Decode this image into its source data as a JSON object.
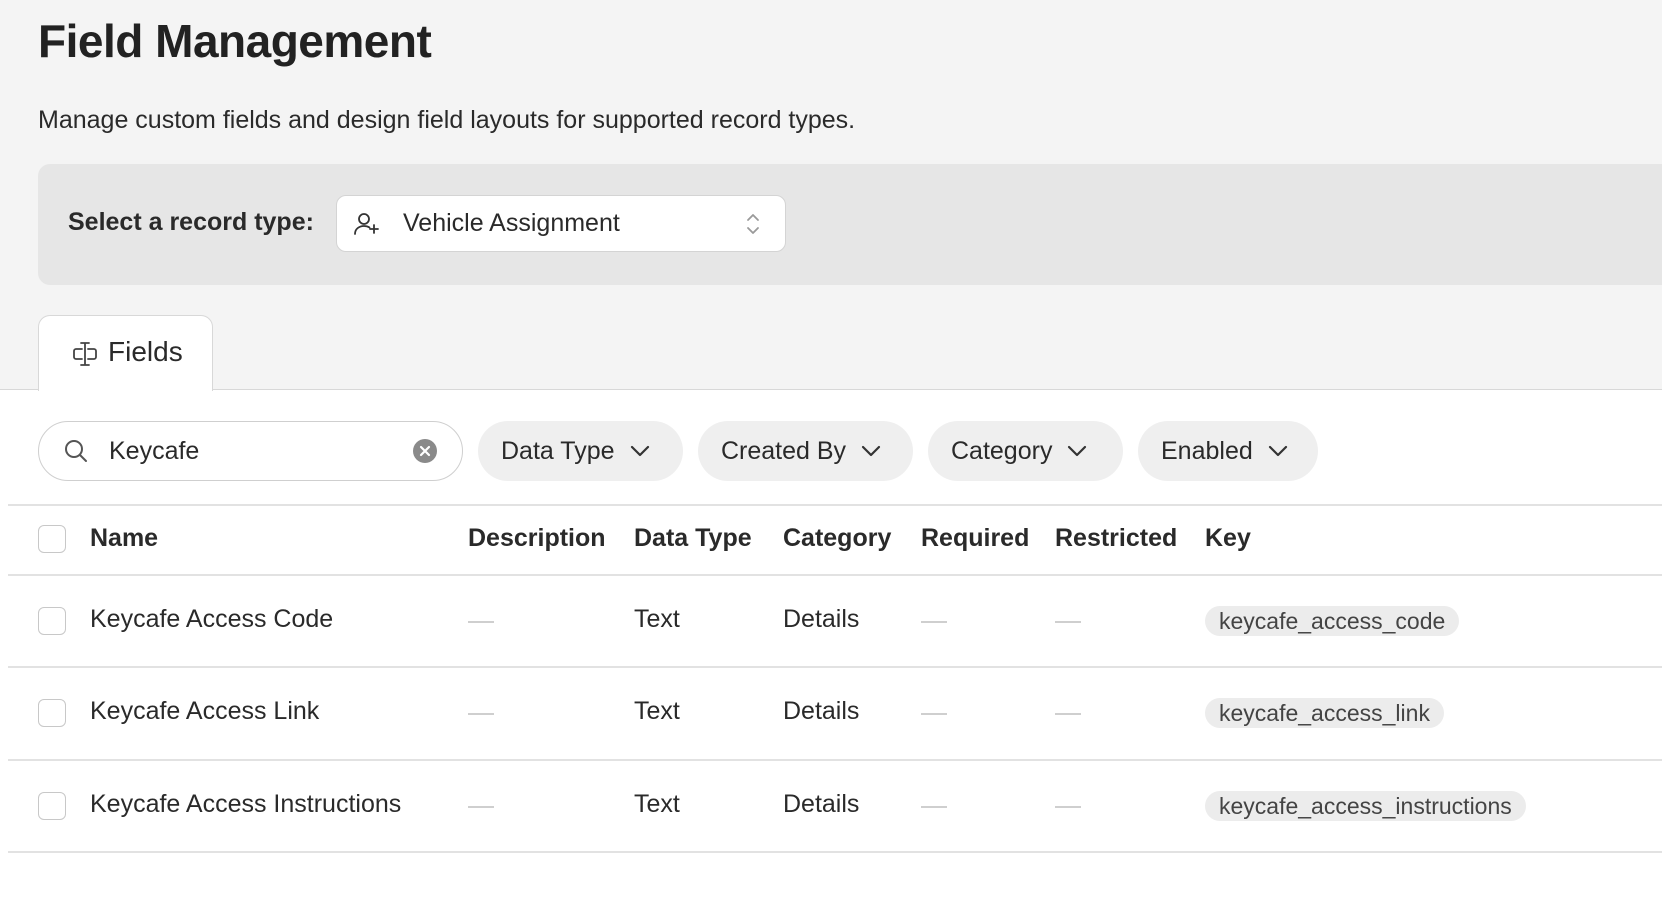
{
  "page": {
    "title": "Field Management",
    "subtitle": "Manage custom fields and design field layouts for supported record types."
  },
  "record_type": {
    "label": "Select a record type:",
    "selected": "Vehicle Assignment"
  },
  "tabs": [
    {
      "label": "Fields",
      "active": true
    }
  ],
  "search": {
    "value": "Keycafe"
  },
  "filters": [
    {
      "label": "Data Type"
    },
    {
      "label": "Created By"
    },
    {
      "label": "Category"
    },
    {
      "label": "Enabled"
    }
  ],
  "table": {
    "columns": [
      "Name",
      "Description",
      "Data Type",
      "Category",
      "Required",
      "Restricted",
      "Key"
    ],
    "rows": [
      {
        "name": "Keycafe Access Code",
        "description": "—",
        "data_type": "Text",
        "category": "Details",
        "required": "—",
        "restricted": "—",
        "key": "keycafe_access_code"
      },
      {
        "name": "Keycafe Access Link",
        "description": "—",
        "data_type": "Text",
        "category": "Details",
        "required": "—",
        "restricted": "—",
        "key": "keycafe_access_link"
      },
      {
        "name": "Keycafe Access Instructions",
        "description": "—",
        "data_type": "Text",
        "category": "Details",
        "required": "—",
        "restricted": "—",
        "key": "keycafe_access_instructions"
      }
    ]
  },
  "icons": {
    "record_type": "person-add-icon",
    "select_arrows": "chevron-up-down-icon",
    "tab": "input-field-icon",
    "search": "search-icon",
    "clear": "clear-circle-icon",
    "filter": "chevron-down-icon"
  },
  "colors": {
    "page_bg": "#f4f4f4",
    "panel_bg": "#e6e6e6",
    "chip_bg": "#efefef",
    "key_pill_bg": "#ececec",
    "text": "#2a2a2a"
  }
}
